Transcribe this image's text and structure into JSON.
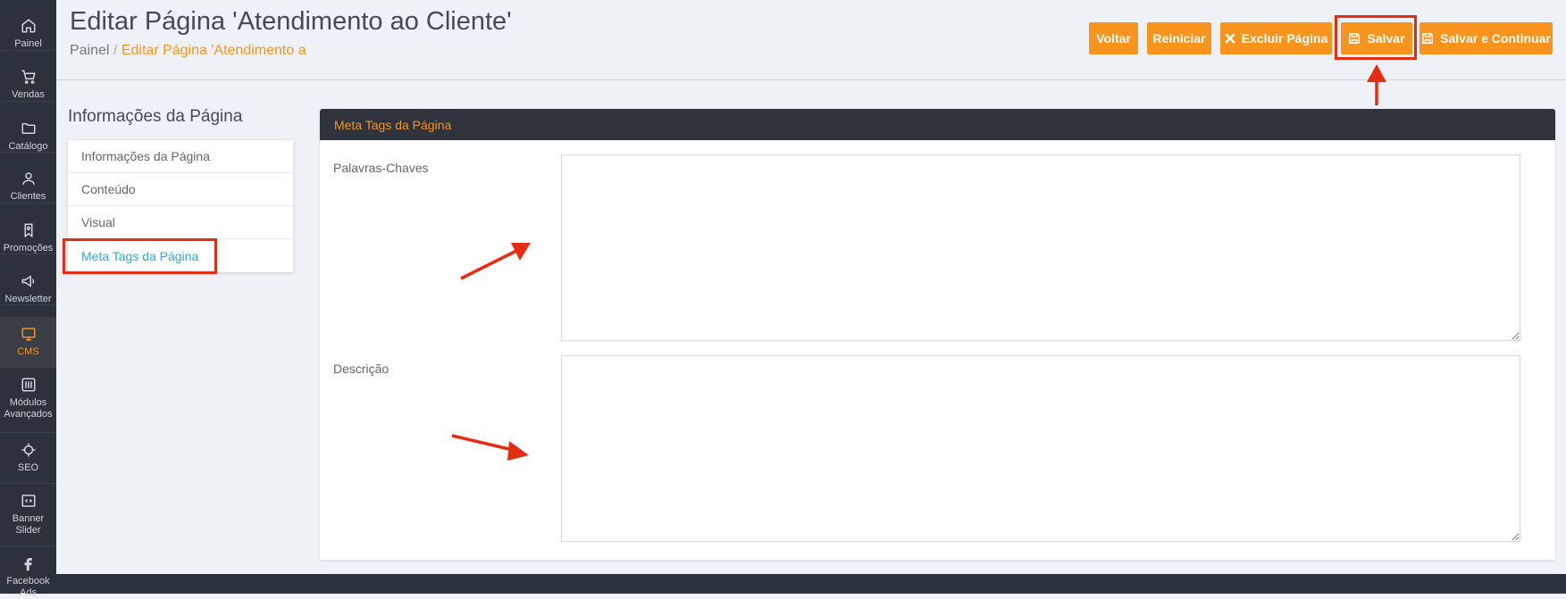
{
  "sidebar": {
    "items": [
      {
        "label": "Painel",
        "icon": "home-icon",
        "active": false
      },
      {
        "label": "Vendas",
        "icon": "cart-icon",
        "active": false
      },
      {
        "label": "Catálogo",
        "icon": "folder-icon",
        "active": false
      },
      {
        "label": "Clientes",
        "icon": "user-icon",
        "active": false
      },
      {
        "label": "Promoções",
        "icon": "bookmark-icon",
        "active": false
      },
      {
        "label": "Newsletter",
        "icon": "megaphone-icon",
        "active": false
      },
      {
        "label": "CMS",
        "icon": "monitor-icon",
        "active": true
      },
      {
        "label": "Módulos Avançados",
        "icon": "sliders-icon",
        "active": false
      },
      {
        "label": "SEO",
        "icon": "crosshair-icon",
        "active": false
      },
      {
        "label": "Banner Slider",
        "icon": "code-icon",
        "active": false
      },
      {
        "label": "Facebook Ads",
        "icon": "facebook-icon",
        "active": false
      }
    ]
  },
  "header": {
    "title": "Editar Página 'Atendimento ao Cliente'",
    "breadcrumb": {
      "root": "Painel",
      "separator": "/",
      "current": "Editar Página 'Atendimento a"
    },
    "buttons": {
      "back": "Voltar",
      "reset": "Reiniciar",
      "delete": "Excluir Página",
      "save": "Salvar",
      "save_continue": "Salvar e Continuar"
    }
  },
  "left_panel": {
    "title": "Informações da Página",
    "tabs": [
      {
        "label": "Informações da Página",
        "active": false
      },
      {
        "label": "Conteúdo",
        "active": false
      },
      {
        "label": "Visual",
        "active": false
      },
      {
        "label": "Meta Tags da Página",
        "active": true
      }
    ]
  },
  "main_panel": {
    "title": "Meta Tags da Página",
    "fields": [
      {
        "label": "Palavras-Chaves",
        "value": ""
      },
      {
        "label": "Descrição",
        "value": ""
      }
    ]
  },
  "colors": {
    "accent": "#f7941d",
    "sidebar_bg": "#2c323c",
    "panel_header_bg": "#2e333c",
    "annotation_red": "#e52d12",
    "link_blue": "#2fa9d8"
  }
}
